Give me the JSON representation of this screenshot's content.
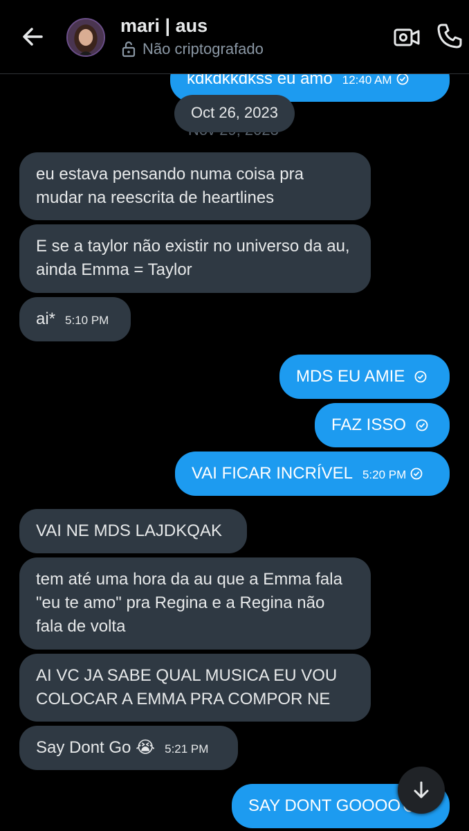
{
  "header": {
    "name": "mari | aus",
    "status": "Não criptografado"
  },
  "dates": {
    "pill": "Oct 26, 2023",
    "ghost": "Nov 29, 2023"
  },
  "messages": [
    {
      "dir": "sent",
      "text": "kdkdkkdkss eu amo",
      "time": "12:40 AM"
    },
    {
      "dir": "recv",
      "text": "eu estava pensando numa coisa pra mudar na reescrita de heartlines"
    },
    {
      "dir": "recv",
      "text": "E se a taylor não existir no universo da au, ainda Emma = Taylor"
    },
    {
      "dir": "recv",
      "text": "ai*",
      "time": "5:10 PM"
    },
    {
      "dir": "sent",
      "text": "MDS EU AMIE"
    },
    {
      "dir": "sent",
      "text": "FAZ ISSO"
    },
    {
      "dir": "sent",
      "text": "VAI FICAR INCRÍVEL",
      "time": "5:20 PM"
    },
    {
      "dir": "recv",
      "text": "VAI NE MDS LAJDKQAK"
    },
    {
      "dir": "recv",
      "text": "tem até uma hora da au que a Emma fala \"eu te amo\" pra Regina e a Regina não fala de volta"
    },
    {
      "dir": "recv",
      "text": "AI VC JA SABE QUAL MUSICA EU VOU COLOCAR A EMMA PRA COMPOR NE"
    },
    {
      "dir": "recv",
      "text": "Say Dont Go 😭",
      "time": "5:21 PM"
    },
    {
      "dir": "sent",
      "text": "SAY DONT GOOOO"
    }
  ],
  "icons": {
    "back": "arrow-left-icon",
    "lock": "unlock-icon",
    "video": "video-camera-icon",
    "call": "phone-icon",
    "read": "check-circle-icon",
    "scroll": "arrow-down-icon"
  },
  "colors": {
    "background": "#000000",
    "sent_bubble": "#1d9bf0",
    "received_bubble": "#2f3943",
    "muted_text": "#8b98a5"
  }
}
